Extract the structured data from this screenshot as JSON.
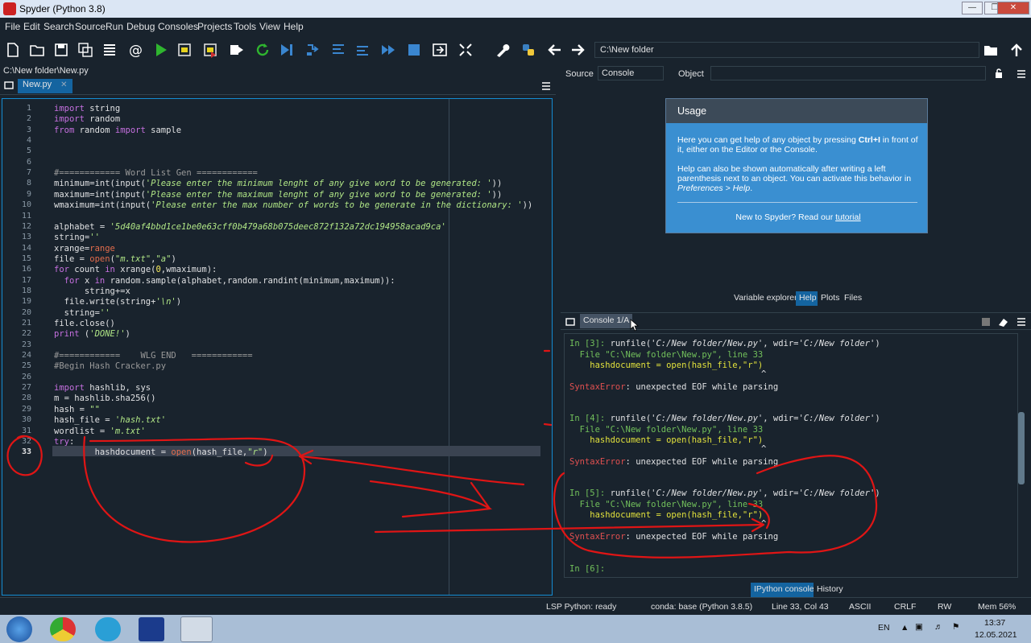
{
  "window": {
    "title": "Spyder (Python 3.8)"
  },
  "menu": [
    "File",
    "Edit",
    "Search",
    "Source",
    "Run",
    "Debug",
    "Consoles",
    "Projects",
    "Tools",
    "View",
    "Help"
  ],
  "toolbar": {
    "path": "C:\\New folder"
  },
  "editor": {
    "file_path": "C:\\New folder\\New.py",
    "tab_label": "New.py",
    "current_line": "33"
  },
  "code_lines": [
    "import string",
    "import random",
    "from random import sample",
    "",
    "",
    "",
    "#============ Word List Gen ============",
    "minimum=int(input('Please enter the minimum lenght of any give word to be generated: '))",
    "maximum=int(input('Please enter the maximum lenght of any give word to be generated: '))",
    "wmaximum=int(input('Please enter the max number of words to be generate in the dictionary: '))",
    "",
    "alphabet = '5d40af4bbd1ce1be0e63cff0b479a68b075deec872f132a72dc194958acad9ca'",
    "string=''",
    "xrange=range",
    "file = open(\"m.txt\",\"a\")",
    "for count in xrange(0,wmaximum):",
    "  for x in random.sample(alphabet,random.randint(minimum,maximum)):",
    "      string+=x",
    "  file.write(string+'\\n')",
    "  string=''",
    "file.close()",
    "print ('DONE!')",
    "",
    "#============    WLG END   ============",
    "#Begin Hash Cracker.py",
    "",
    "import hashlib, sys",
    "m = hashlib.sha256()",
    "hash = \"\"",
    "hash_file = 'hash.txt'",
    "wordlist = 'm.txt'",
    "try:",
    "        hashdocument = open(hash_file,\"r\")"
  ],
  "help_pane": {
    "source_label": "Source",
    "source_value": "Console",
    "object_label": "Object",
    "usage_title": "Usage",
    "usage_p1a": "Here you can get help of any object by pressing ",
    "usage_p1b": "Ctrl+I",
    "usage_p1c": " in front of it, either on the Editor or the Console.",
    "usage_p2a": "Help can also be shown automatically after writing a left parenthesis next to an object. You can activate this behavior in ",
    "usage_p2b": "Preferences > Help",
    "usage_p2c": ".",
    "usage_foot": "New to Spyder? Read our ",
    "usage_link": "tutorial",
    "tabs": [
      "Variable explorer",
      "Help",
      "Plots",
      "Files"
    ]
  },
  "console": {
    "tab_label": "Console 1/A",
    "blocks": [
      {
        "prompt": "In [3]: ",
        "cmd": "runfile(",
        "arg1": "'C:/New folder/New.py'",
        "mid": ", wdir=",
        "arg2": "'C:/New folder'",
        "close": ")"
      },
      {
        "prompt": "In [4]: ",
        "cmd": "runfile(",
        "arg1": "'C:/New folder/New.py'",
        "mid": ", wdir=",
        "arg2": "'C:/New folder'",
        "close": ")"
      },
      {
        "prompt": "In [5]: ",
        "cmd": "runfile(",
        "arg1": "'C:/New folder/New.py'",
        "mid": ", wdir=",
        "arg2": "'C:/New folder'",
        "close": ")"
      }
    ],
    "file_line": "  File \"C:\\New folder\\New.py\", line 33",
    "code_line": "    hashdocument = open(hash_file,\"r\")",
    "caret": "^",
    "error_name": "SyntaxError",
    "error_msg": ": unexpected EOF while parsing",
    "final_prompt": "In [6]: ",
    "bottom_tabs": [
      "IPython console",
      "History"
    ]
  },
  "status": {
    "lsp": "LSP Python: ready",
    "conda": "conda: base (Python 3.8.5)",
    "position": "Line 33, Col 43",
    "encoding": "ASCII",
    "eol": "CRLF",
    "mode": "RW",
    "mem": "Mem 56%"
  },
  "taskbar": {
    "lang": "EN",
    "time": "13:37",
    "date": "12.05.2021"
  }
}
